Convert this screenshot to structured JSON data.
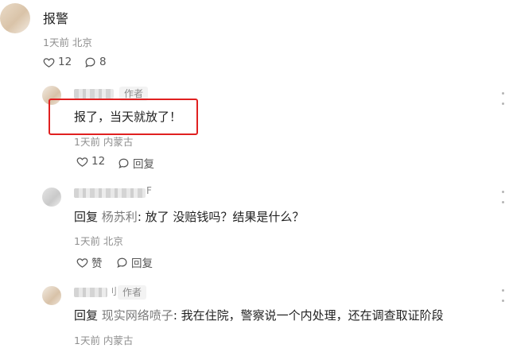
{
  "main_comment": {
    "text": "报警",
    "meta": "1天前 北京",
    "likes": "12",
    "replies": "8"
  },
  "replies": [
    {
      "name_tail": "",
      "author_tag": "作者",
      "text": "报了，当天就放了！",
      "meta": "1天前 内蒙古",
      "likes": "12",
      "reply_label": "回复"
    },
    {
      "name_tail": "F",
      "reply_prefix": "回复",
      "reply_to": "杨苏利",
      "text": ": 放了 没赔钱吗？结果是什么？",
      "meta": "1天前 北京",
      "like_label": "赞",
      "reply_label": "回复"
    },
    {
      "name_tail": "刂",
      "author_tag": "作者",
      "reply_prefix": "回复",
      "reply_to": "现实网络喷子",
      "text": ": 我在住院，警察说一个内处理，还在调查取证阶段",
      "meta": "1天前 内蒙古"
    }
  ],
  "colors": {
    "highlight": "#e02020",
    "meta": "#8f8f8f"
  },
  "icons": [
    "heart-icon",
    "comment-bubble-icon",
    "more-dots-icon"
  ]
}
